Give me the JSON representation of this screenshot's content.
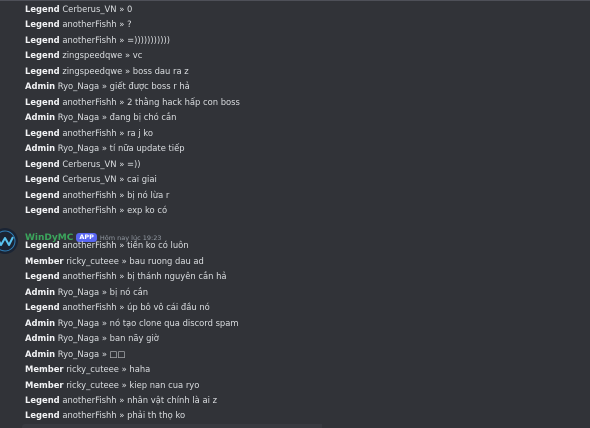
{
  "bot": {
    "name": "WinDyMC",
    "badge": "APP",
    "timestamp": "Hôm nay lúc 19:23"
  },
  "separator": "»",
  "messages_before": [
    {
      "rank": "Legend",
      "user": "Cerberus_VN",
      "text": "0"
    },
    {
      "rank": "Legend",
      "user": "anotherFishh",
      "text": "?"
    },
    {
      "rank": "Legend",
      "user": "anotherFishh",
      "text": "=)))))))))))"
    },
    {
      "rank": "Legend",
      "user": "zingspeedqwe",
      "text": "vc"
    },
    {
      "rank": "Legend",
      "user": "zingspeedqwe",
      "text": "boss dau ra z"
    },
    {
      "rank": "Admin",
      "user": "Ryo_Naga",
      "text": "giết được boss r hả"
    },
    {
      "rank": "Legend",
      "user": "anotherFishh",
      "text": "2 thằng hack hấp con boss"
    },
    {
      "rank": "Admin",
      "user": "Ryo_Naga",
      "text": "đang bị chó cắn"
    },
    {
      "rank": "Legend",
      "user": "anotherFishh",
      "text": "ra j ko"
    },
    {
      "rank": "Admin",
      "user": "Ryo_Naga",
      "text": "tí nữa update tiếp"
    },
    {
      "rank": "Legend",
      "user": "Cerberus_VN",
      "text": "=))"
    },
    {
      "rank": "Legend",
      "user": "Cerberus_VN",
      "text": "cai giai"
    },
    {
      "rank": "Legend",
      "user": "anotherFishh",
      "text": "bị nó lừa r"
    },
    {
      "rank": "Legend",
      "user": "anotherFishh",
      "text": "exp ko có"
    }
  ],
  "messages_after": [
    {
      "rank": "Legend",
      "user": "anotherFishh",
      "text": "tiền ko có luôn"
    },
    {
      "rank": "Member",
      "user": "ricky_cuteee",
      "text": "bau ruong dau ad"
    },
    {
      "rank": "Legend",
      "user": "anotherFishh",
      "text": "bị thánh nguyên cắn hả"
    },
    {
      "rank": "Admin",
      "user": "Ryo_Naga",
      "text": "bị nó cắn"
    },
    {
      "rank": "Legend",
      "user": "anotherFishh",
      "text": "úp bô vô cái đầu nó"
    },
    {
      "rank": "Admin",
      "user": "Ryo_Naga",
      "text": "nó tạo clone qua discord spam"
    },
    {
      "rank": "Admin",
      "user": "Ryo_Naga",
      "text": "ban nãy giờ"
    },
    {
      "rank": "Admin",
      "user": "Ryo_Naga",
      "text": "□□"
    },
    {
      "rank": "Member",
      "user": "ricky_cuteee",
      "text": "haha"
    },
    {
      "rank": "Member",
      "user": "ricky_cuteee",
      "text": "kiep nan cua ryo"
    },
    {
      "rank": "Legend",
      "user": "anotherFishh",
      "text": "nhân vật chính là ai z"
    },
    {
      "rank": "Legend",
      "user": "anotherFishh",
      "text": "phải th thọ ko"
    }
  ],
  "colors": {
    "background": "#313338",
    "bot_name": "#3ba55c",
    "app_badge": "#5865f2"
  },
  "icons": {
    "avatar": "windymc-avatar-icon"
  }
}
